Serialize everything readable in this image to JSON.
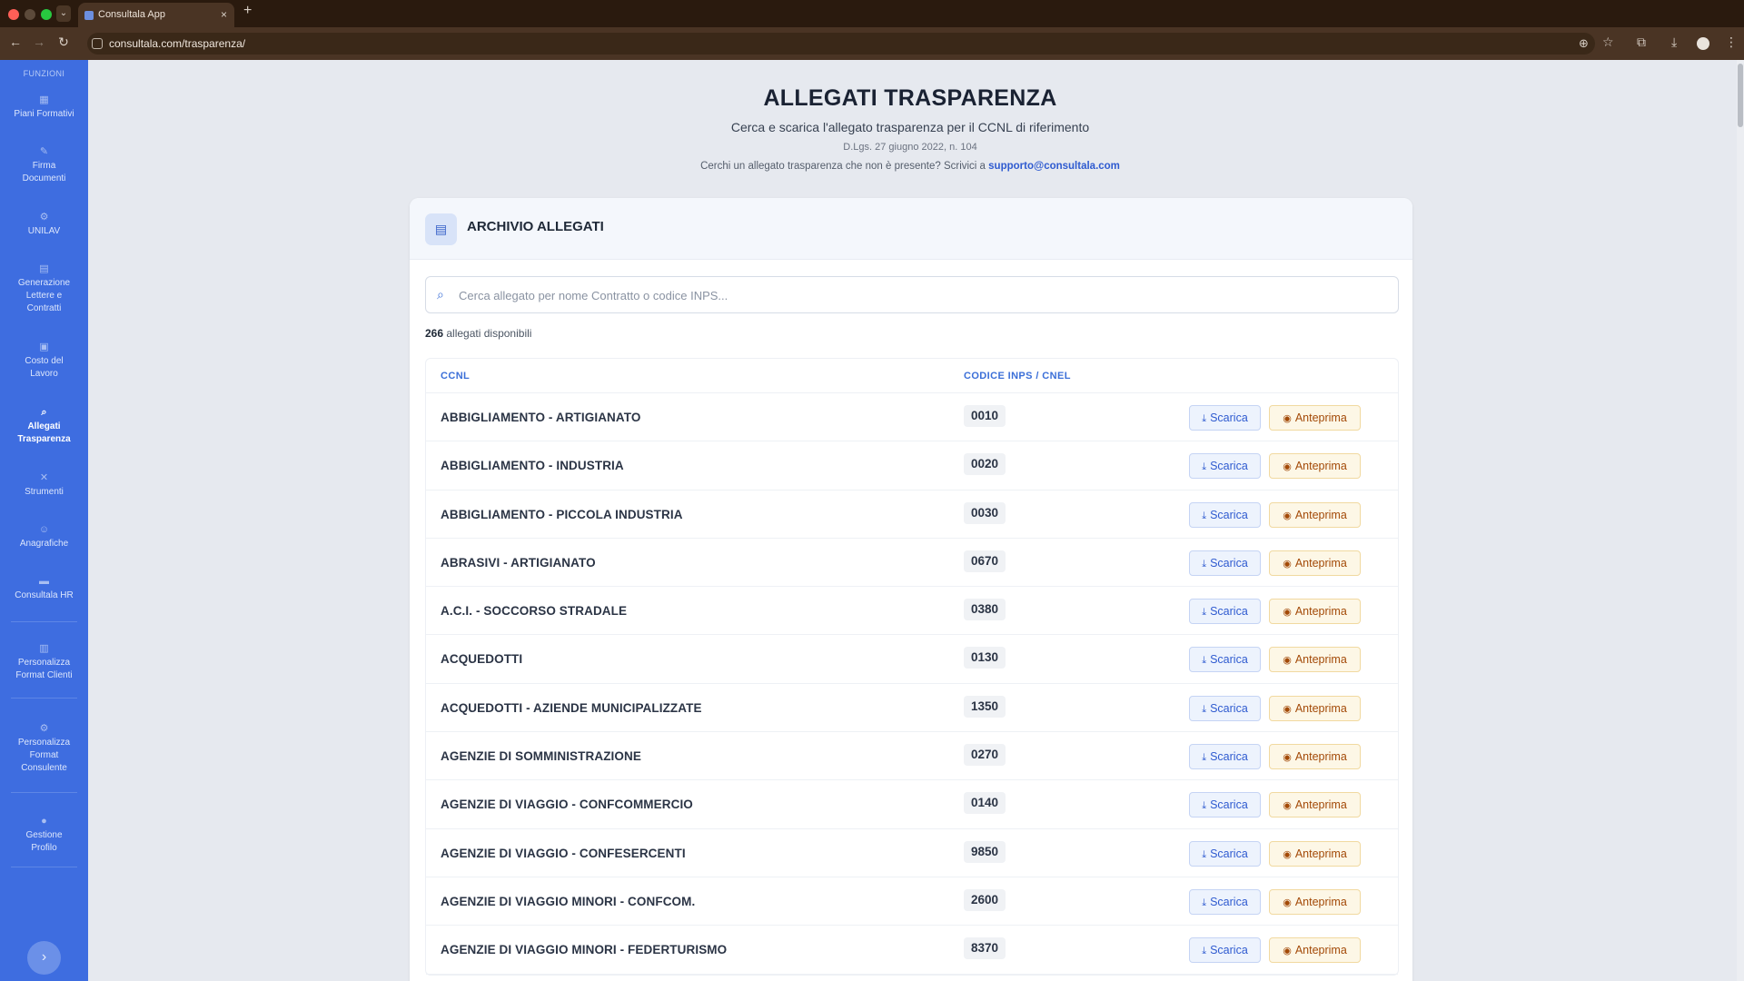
{
  "browser": {
    "tab_title": "Consultala App",
    "tab_close": "×",
    "new_tab": "+",
    "tab_dropdown": "⌄",
    "url": "consultala.com/trasparenza/",
    "back": "←",
    "forward": "→",
    "reload": "↻"
  },
  "sidebar": {
    "heading": "FUNZIONI",
    "toggle": "›",
    "items": [
      {
        "icon": "▦",
        "label": "Piani Formativi"
      },
      {
        "icon": "✎",
        "label": "Firma Documenti"
      },
      {
        "icon": "⚙",
        "label": "UNILAV"
      },
      {
        "icon": "▤",
        "label": "Generazione Lettere e Contratti"
      },
      {
        "icon": "▣",
        "label": "Costo del Lavoro"
      },
      {
        "icon": "⌕",
        "label": "Allegati Trasparenza"
      },
      {
        "icon": "✕",
        "label": "Strumenti"
      },
      {
        "icon": "☺",
        "label": "Anagrafiche"
      },
      {
        "icon": "▬",
        "label": "Consultala HR"
      },
      {
        "icon": "▥",
        "label": "Personalizza Format Clienti"
      },
      {
        "icon": "⚙",
        "label": "Personalizza Format Consulente"
      },
      {
        "icon": "●",
        "label": "Gestione Profilo"
      }
    ]
  },
  "page": {
    "title": "ALLEGATI TRASPARENZA",
    "subtitle": "Cerca e scarica l'allegato trasparenza per il CCNL di riferimento",
    "law": "D.Lgs. 27 giugno 2022, n. 104",
    "help_text": "Cerchi un allegato trasparenza che non è presente? Scrivici a",
    "help_email": "supporto@consultala.com"
  },
  "archive": {
    "title": "ARCHIVIO ALLEGATI",
    "search_placeholder": "Cerca allegato per nome Contratto o codice INPS...",
    "count": "266",
    "count_label": "allegati disponibili",
    "columns": {
      "ccnl": "CCNL",
      "code": "CODICE INPS / CNEL"
    },
    "download_label": "Scarica",
    "preview_label": "Anteprima",
    "rows": [
      {
        "name": "ABBIGLIAMENTO - ARTIGIANATO",
        "code": "0010"
      },
      {
        "name": "ABBIGLIAMENTO - INDUSTRIA",
        "code": "0020"
      },
      {
        "name": "ABBIGLIAMENTO - PICCOLA INDUSTRIA",
        "code": "0030"
      },
      {
        "name": "ABRASIVI - ARTIGIANATO",
        "code": "0670"
      },
      {
        "name": "A.C.I. - SOCCORSO STRADALE",
        "code": "0380"
      },
      {
        "name": "ACQUEDOTTI",
        "code": "0130"
      },
      {
        "name": "ACQUEDOTTI - AZIENDE MUNICIPALIZZATE",
        "code": "1350"
      },
      {
        "name": "AGENZIE DI SOMMINISTRAZIONE",
        "code": "0270"
      },
      {
        "name": "AGENZIE DI VIAGGIO - CONFCOMMERCIO",
        "code": "0140"
      },
      {
        "name": "AGENZIE DI VIAGGIO - CONFESERCENTI",
        "code": "9850"
      },
      {
        "name": "AGENZIE DI VIAGGIO MINORI - CONFCOM.",
        "code": "2600"
      },
      {
        "name": "AGENZIE DI VIAGGIO MINORI - FEDERTURISMO",
        "code": "8370"
      }
    ]
  }
}
